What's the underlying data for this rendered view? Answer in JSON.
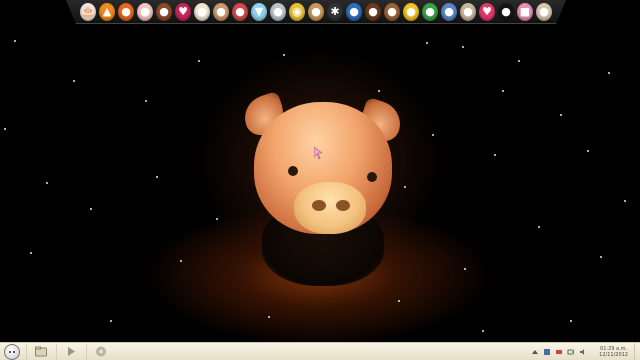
{
  "dock": {
    "items": [
      {
        "name": "birthday-cake-icon",
        "glyph": "🎂",
        "color": "#f2e6e6"
      },
      {
        "name": "vlc-cone-icon",
        "glyph": "▲",
        "color": "#f08a1c"
      },
      {
        "name": "orange-creature-icon",
        "glyph": "●",
        "color": "#e36a1b"
      },
      {
        "name": "cupcake-icon",
        "glyph": "●",
        "color": "#f3c7c2"
      },
      {
        "name": "cake-slice-icon",
        "glyph": "●",
        "color": "#8a4a2a"
      },
      {
        "name": "heart-pink-icon",
        "glyph": "♥",
        "color": "#c9265a"
      },
      {
        "name": "bunny-icon",
        "glyph": "●",
        "color": "#efe6d2"
      },
      {
        "name": "bear-icon",
        "glyph": "●",
        "color": "#c99a72"
      },
      {
        "name": "mushroom-icon",
        "glyph": "●",
        "color": "#d04a4a"
      },
      {
        "name": "ice-cream-icon",
        "glyph": "▼",
        "color": "#8fd3f0"
      },
      {
        "name": "bird-icon",
        "glyph": "●",
        "color": "#b9c4cc"
      },
      {
        "name": "chrome-icon",
        "glyph": "◉",
        "color": "#e8c23a"
      },
      {
        "name": "cookie-icon",
        "glyph": "●",
        "color": "#c89a5a"
      },
      {
        "name": "spider-icon",
        "glyph": "✱",
        "color": "#333333"
      },
      {
        "name": "blue-monster-icon",
        "glyph": "●",
        "color": "#2b6fbf"
      },
      {
        "name": "coffee-bean-icon",
        "glyph": "●",
        "color": "#6b3b1f"
      },
      {
        "name": "acorn-icon",
        "glyph": "●",
        "color": "#9a6436"
      },
      {
        "name": "duck-icon",
        "glyph": "●",
        "color": "#f3c321"
      },
      {
        "name": "frog-icon",
        "glyph": "●",
        "color": "#3aa14a"
      },
      {
        "name": "globe-icon",
        "glyph": "●",
        "color": "#5a86c8"
      },
      {
        "name": "cat-icon",
        "glyph": "●",
        "color": "#c9b79d"
      },
      {
        "name": "heart-icon",
        "glyph": "♥",
        "color": "#e2396c"
      },
      {
        "name": "soot-sprite-icon",
        "glyph": "●",
        "color": "#151515"
      },
      {
        "name": "book-icon",
        "glyph": "■",
        "color": "#e58fb1"
      },
      {
        "name": "cookie-face-icon",
        "glyph": "●",
        "color": "#d8c7b0"
      }
    ]
  },
  "taskbar": {
    "clock_time": "01:29 a.m.",
    "clock_date": "12/11/2012"
  },
  "colors": {
    "taskbar_bg": "#efe9d4",
    "dock_bg": "#1a1a1a"
  }
}
